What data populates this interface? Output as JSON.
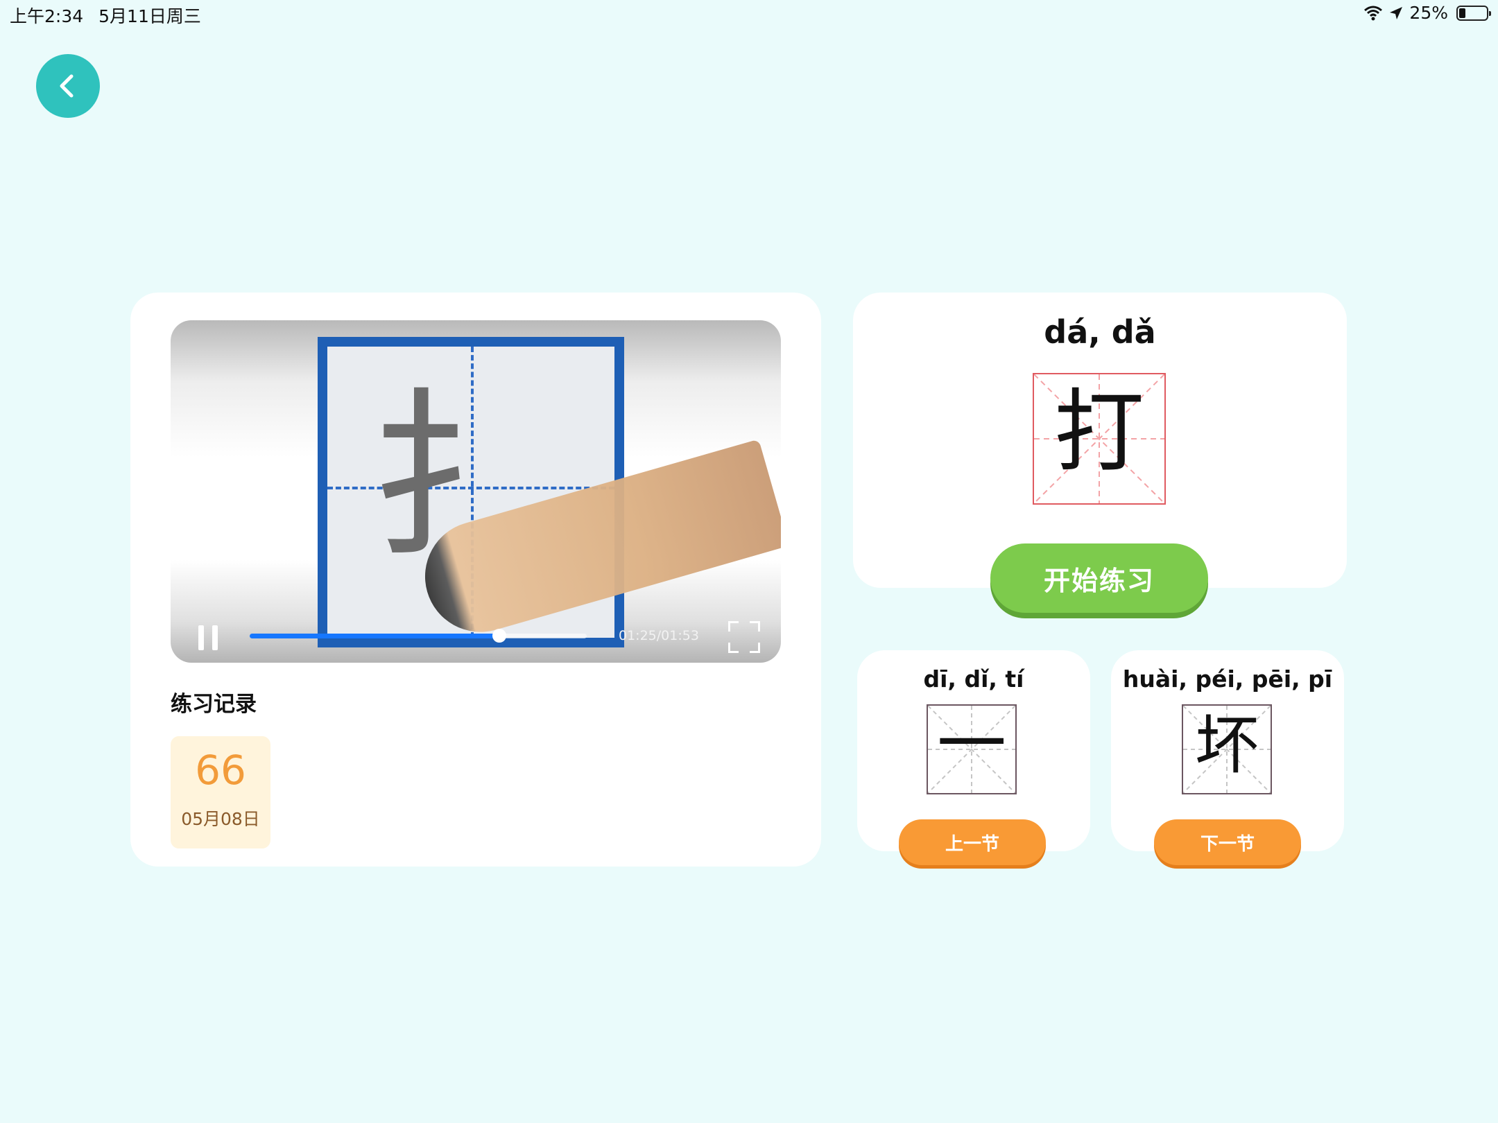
{
  "status_bar": {
    "time": "上午2:34",
    "date": "5月11日周三",
    "battery": "25%"
  },
  "video": {
    "char": "扌",
    "time": "01:25/01:53",
    "progress": 0.74
  },
  "record": {
    "title": "练习记录",
    "items": [
      {
        "score": "66",
        "date": "05月08日"
      }
    ]
  },
  "current": {
    "pinyin": "dá, dǎ",
    "char": "打",
    "start_label": "开始练习"
  },
  "prev": {
    "pinyin": "dī, dǐ, tí",
    "char": "一",
    "button_label": "上一节"
  },
  "next": {
    "pinyin": "huài, péi, pēi, pī",
    "char": "坏",
    "button_label": "下一节"
  },
  "colors": {
    "background": "#eafbfb",
    "teal": "#2fc2bd",
    "green": "#7dcb4c",
    "orange": "#f99a35",
    "progress": "#1677ff"
  }
}
